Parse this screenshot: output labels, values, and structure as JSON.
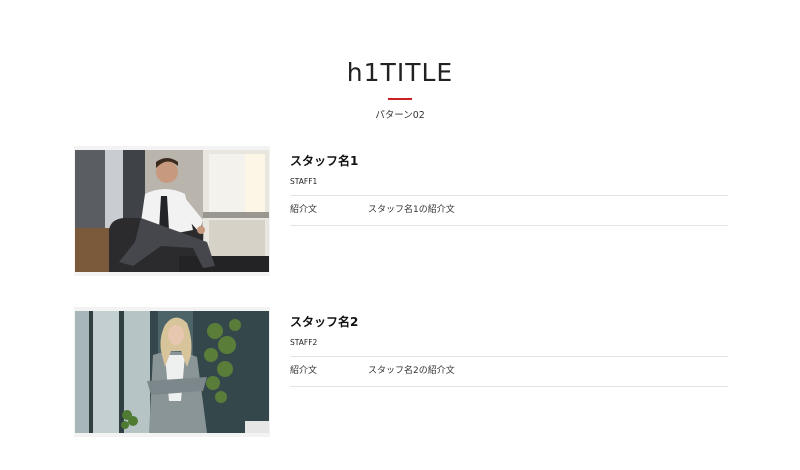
{
  "header": {
    "title": "h1TITLE",
    "subtitle": "パターン02",
    "accent_color": "#cc1f1f"
  },
  "staff": [
    {
      "name": "スタッフ名1",
      "name_en": "STAFF1",
      "intro_label": "紹介文",
      "intro_text": "スタッフ名1の紹介文"
    },
    {
      "name": "スタッフ名2",
      "name_en": "STAFF2",
      "intro_label": "紹介文",
      "intro_text": "スタッフ名2の紹介文"
    }
  ]
}
